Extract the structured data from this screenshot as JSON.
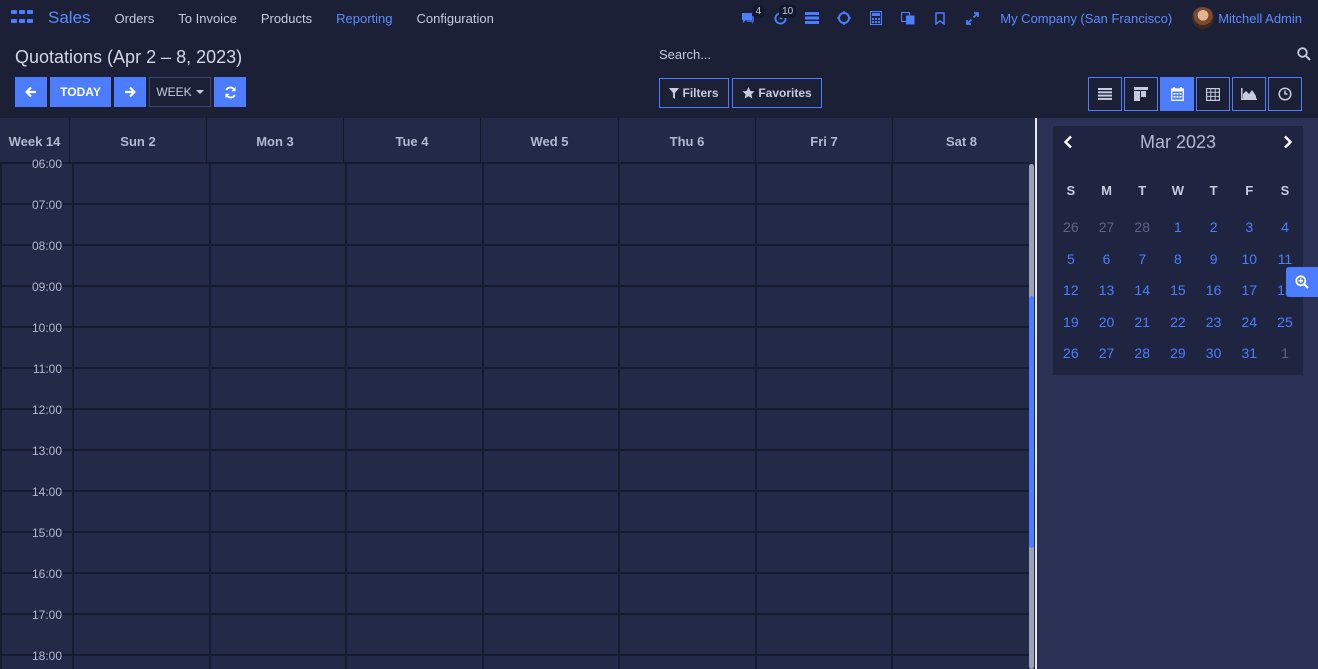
{
  "nav": {
    "brand": "Sales",
    "menu": [
      "Orders",
      "To Invoice",
      "Products",
      "Reporting",
      "Configuration"
    ],
    "messages_count": "4",
    "activities_count": "10",
    "company": "My Company (San Francisco)",
    "user": "Mitchell Admin"
  },
  "control": {
    "title": "Quotations (Apr 2 – 8, 2023)",
    "search_placeholder": "Search...",
    "today_label": "TODAY",
    "week_label": "WEEK",
    "filters_label": "Filters",
    "favorites_label": "Favorites"
  },
  "calendar": {
    "week_label": "Week 14",
    "days": [
      "Sun 2",
      "Mon 3",
      "Tue 4",
      "Wed 5",
      "Thu 6",
      "Fri 7",
      "Sat 8"
    ],
    "hours": [
      "06:00",
      "07:00",
      "08:00",
      "09:00",
      "10:00",
      "11:00",
      "12:00",
      "13:00",
      "14:00",
      "15:00",
      "16:00",
      "17:00",
      "18:00"
    ]
  },
  "mini_calendar": {
    "title": "Mar 2023",
    "dow": [
      "S",
      "M",
      "T",
      "W",
      "T",
      "F",
      "S"
    ],
    "weeks": [
      [
        "26",
        "27",
        "28",
        "1",
        "2",
        "3",
        "4"
      ],
      [
        "5",
        "6",
        "7",
        "8",
        "9",
        "10",
        "11"
      ],
      [
        "12",
        "13",
        "14",
        "15",
        "16",
        "17",
        "18"
      ],
      [
        "19",
        "20",
        "21",
        "22",
        "23",
        "24",
        "25"
      ],
      [
        "26",
        "27",
        "28",
        "29",
        "30",
        "31",
        "1"
      ]
    ]
  },
  "colors": {
    "accent": "#4c7dff",
    "navbar": "#1b2036",
    "background": "#232a47"
  }
}
